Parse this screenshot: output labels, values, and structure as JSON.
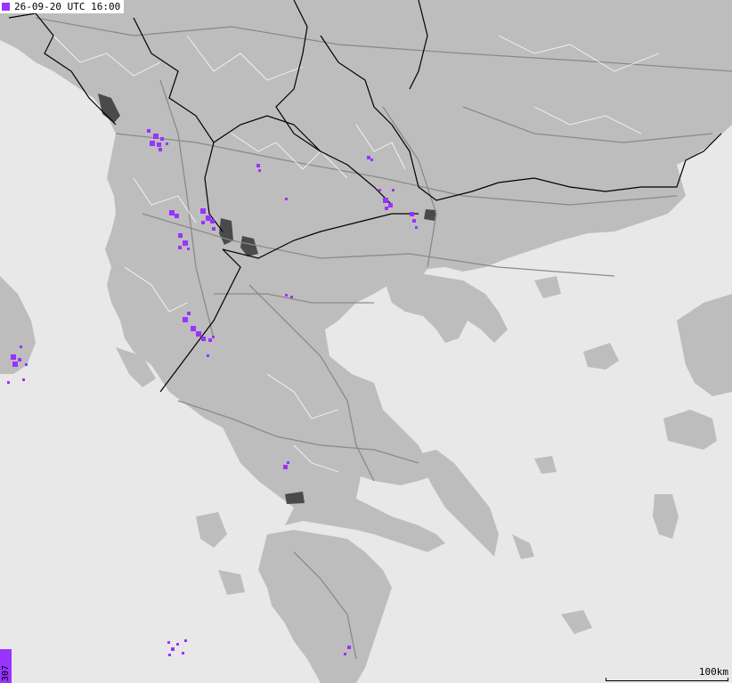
{
  "timestamp": {
    "text": "26-09-20 UTC 16:00"
  },
  "strike_count": {
    "text": "307"
  },
  "scale": {
    "label": "100km"
  },
  "colors": {
    "sea": "#e8e8e8",
    "land": "#bdbdbd",
    "lake": "#4a4a4a",
    "roads": "#8a8a8a",
    "borders": "#000000",
    "regions": "#ffffff",
    "strikes": "#9933ff"
  },
  "icons": {
    "map_legend": "lightning-marker-icon"
  }
}
